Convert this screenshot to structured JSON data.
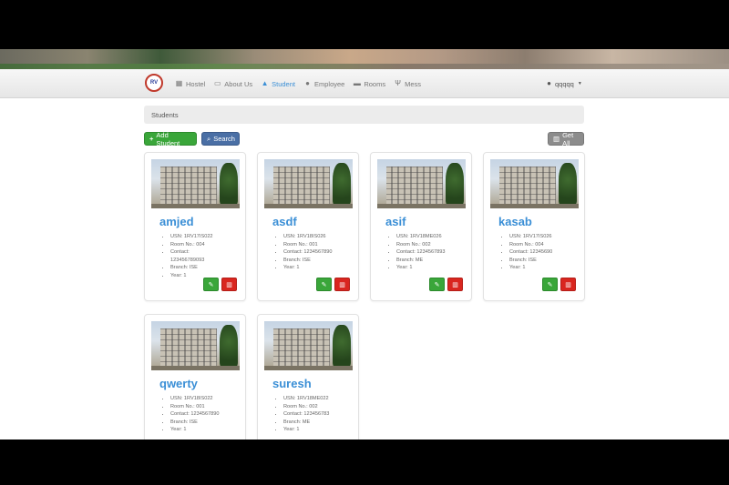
{
  "nav": {
    "logo_text": "RV",
    "items": [
      {
        "label": "Hostel",
        "icon": "building-icon"
      },
      {
        "label": "About Us",
        "icon": "id-card-icon"
      },
      {
        "label": "Student",
        "icon": "student-icon"
      },
      {
        "label": "Employee",
        "icon": "user-icon"
      },
      {
        "label": "Rooms",
        "icon": "bed-icon"
      },
      {
        "label": "Mess",
        "icon": "cutlery-icon"
      }
    ],
    "active": "Student",
    "user": "qqqqq"
  },
  "breadcrumb": {
    "title": "Students"
  },
  "toolbar": {
    "add_label": "Add Student",
    "search_label": "Search",
    "getall_label": "Get All"
  },
  "students": [
    {
      "name": "amjed",
      "usn": "USN: 1RV17IS022",
      "room": "Room No.: 004",
      "contact": "Contact:",
      "contact2": "123456789093",
      "branch": "Branch: ISE",
      "year": "Year: 1"
    },
    {
      "name": "asdf",
      "usn": "USN: 1RV18IS026",
      "room": "Room No.: 001",
      "contact": "Contact: 1234567890",
      "contact2": "",
      "branch": "Branch: ISE",
      "year": "Year: 1"
    },
    {
      "name": "asif",
      "usn": "USN: 1RV18ME026",
      "room": "Room No.: 002",
      "contact": "Contact: 1234567893",
      "contact2": "",
      "branch": "Branch: ME",
      "year": "Year: 1"
    },
    {
      "name": "kasab",
      "usn": "USN: 1RV17IS026",
      "room": "Room No.: 004",
      "contact": "Contact: 12345690",
      "contact2": "",
      "branch": "Branch: ISE",
      "year": "Year: 1"
    },
    {
      "name": "qwerty",
      "usn": "USN: 1RV18IS022",
      "room": "Room No.: 001",
      "contact": "Contact: 1234567890",
      "contact2": "",
      "branch": "Branch: ISE",
      "year": "Year: 1"
    },
    {
      "name": "suresh",
      "usn": "USN: 1RV18ME022",
      "room": "Room No.: 002",
      "contact": "Contact: 123456783",
      "contact2": "",
      "branch": "Branch: ME",
      "year": "Year: 1"
    }
  ],
  "colors": {
    "accent": "#3b8fd6",
    "success": "#3aa63a",
    "danger": "#d9261f",
    "primary": "#4a6fa5"
  }
}
